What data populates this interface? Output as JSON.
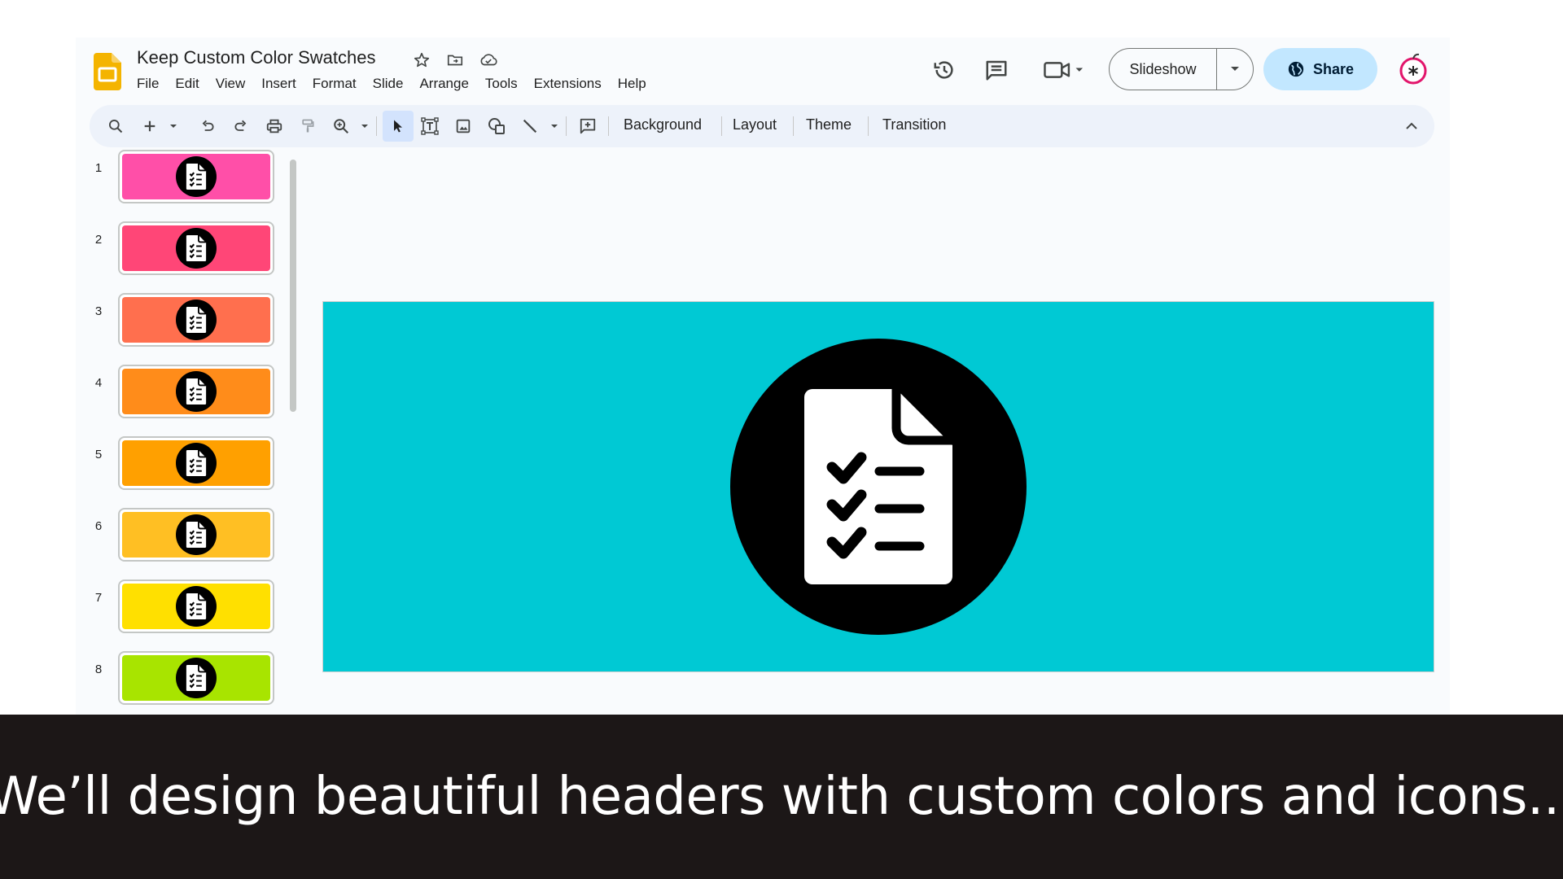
{
  "app": {
    "title": "Keep Custom Color Swatches",
    "menu": [
      "File",
      "Edit",
      "View",
      "Insert",
      "Format",
      "Slide",
      "Arrange",
      "Tools",
      "Extensions",
      "Help"
    ],
    "slideshow_label": "Slideshow",
    "share_label": "Share",
    "header_icons": [
      "star-icon",
      "move-to-folder-icon",
      "cloud-saved-icon",
      "version-history-icon",
      "comments-icon",
      "meet-icon"
    ]
  },
  "toolbar": {
    "background_label": "Background",
    "layout_label": "Layout",
    "theme_label": "Theme",
    "transition_label": "Transition"
  },
  "slides": [
    {
      "number": "1",
      "color": "#ff4fa8"
    },
    {
      "number": "2",
      "color": "#ff4677"
    },
    {
      "number": "3",
      "color": "#ff6f4e"
    },
    {
      "number": "4",
      "color": "#ff8c1a"
    },
    {
      "number": "5",
      "color": "#ffa000"
    },
    {
      "number": "6",
      "color": "#ffbf23"
    },
    {
      "number": "7",
      "color": "#ffe000"
    },
    {
      "number": "8",
      "color": "#a8e400"
    }
  ],
  "current_slide": {
    "background": "#00c9d4",
    "icon": "checklist-document-icon"
  },
  "caption": "We’ll design beautiful headers with custom colors and icons..."
}
